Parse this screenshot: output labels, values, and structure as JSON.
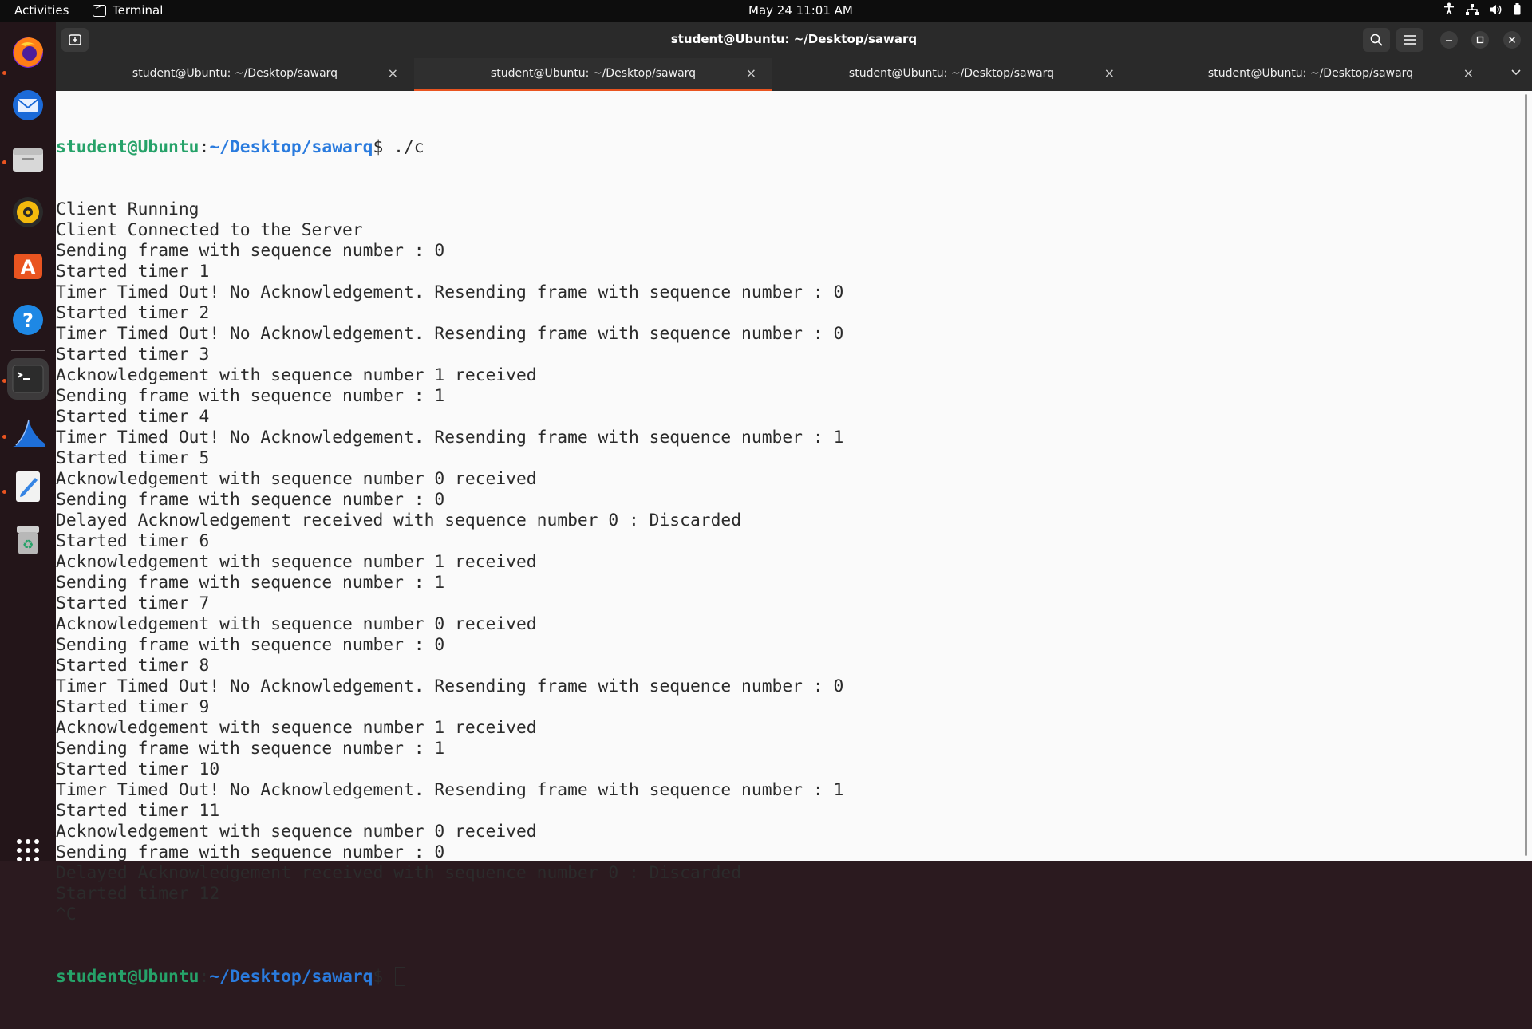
{
  "topbar": {
    "activities": "Activities",
    "app_name": "Terminal",
    "clock": "May 24  11:01 AM",
    "tray_icons": [
      "accessibility-icon",
      "network-icon",
      "volume-icon",
      "battery-icon"
    ]
  },
  "dock": {
    "items": [
      "Firefox",
      "Thunderbird",
      "Files",
      "Rhythmbox",
      "Ubuntu Software",
      "Help",
      "Terminal",
      "Wireshark",
      "Text Editor",
      "Trash",
      "Show Applications"
    ]
  },
  "window": {
    "title": "student@Ubuntu: ~/Desktop/sawarq",
    "tabs": [
      {
        "label": "student@Ubuntu: ~/Desktop/sawarq",
        "active": false
      },
      {
        "label": "student@Ubuntu: ~/Desktop/sawarq",
        "active": true
      },
      {
        "label": "student@Ubuntu: ~/Desktop/sawarq",
        "active": false
      },
      {
        "label": "student@Ubuntu: ~/Desktop/sawarq",
        "active": false
      }
    ],
    "close_glyph": "×"
  },
  "terminal": {
    "prompt_user": "student@Ubuntu",
    "prompt_sep": ":",
    "prompt_path": "~/Desktop/sawarq",
    "prompt_symbol": "$ ",
    "command": "./c",
    "output": [
      "Client Running",
      "Client Connected to the Server",
      "Sending frame with sequence number : 0",
      "Started timer 1",
      "Timer Timed Out! No Acknowledgement. Resending frame with sequence number : 0",
      "Started timer 2",
      "Timer Timed Out! No Acknowledgement. Resending frame with sequence number : 0",
      "Started timer 3",
      "Acknowledgement with sequence number 1 received",
      "Sending frame with sequence number : 1",
      "Started timer 4",
      "Timer Timed Out! No Acknowledgement. Resending frame with sequence number : 1",
      "Started timer 5",
      "Acknowledgement with sequence number 0 received",
      "Sending frame with sequence number : 0",
      "Delayed Acknowledgement received with sequence number 0 : Discarded",
      "Started timer 6",
      "Acknowledgement with sequence number 1 received",
      "Sending frame with sequence number : 1",
      "Started timer 7",
      "Acknowledgement with sequence number 0 received",
      "Sending frame with sequence number : 0",
      "Started timer 8",
      "Timer Timed Out! No Acknowledgement. Resending frame with sequence number : 0",
      "Started timer 9",
      "Acknowledgement with sequence number 1 received",
      "Sending frame with sequence number : 1",
      "Started timer 10",
      "Timer Timed Out! No Acknowledgement. Resending frame with sequence number : 1",
      "Started timer 11",
      "Acknowledgement with sequence number 0 received",
      "Sending frame with sequence number : 0",
      "Delayed Acknowledgement received with sequence number 0 : Discarded",
      "Started timer 12",
      "^C"
    ]
  }
}
